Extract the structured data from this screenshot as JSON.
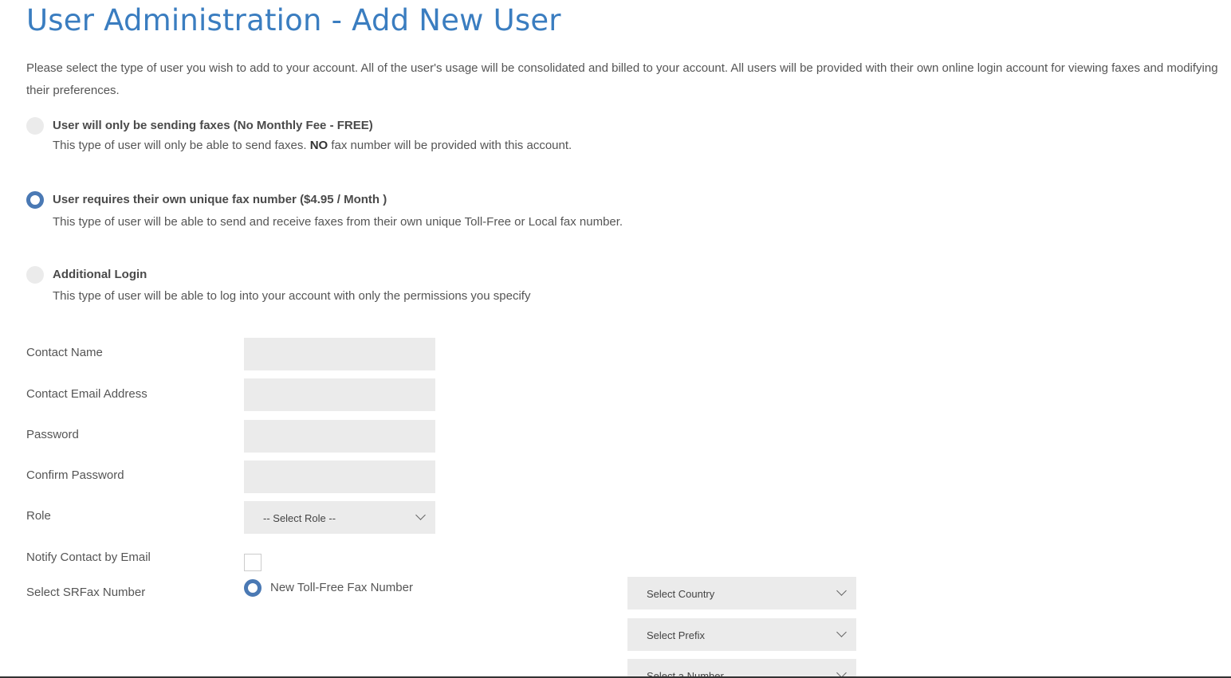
{
  "page": {
    "title": "User Administration - Add New User",
    "intro": "Please select the type of user you wish to add to your account. All of the user's usage will be consolidated and billed to your account. All users will be provided with their own online login account for viewing faxes and modifying their preferences."
  },
  "user_types": [
    {
      "title": "User will only be sending faxes (No Monthly Fee - FREE)",
      "desc_pre": "This type of user will only be able to send faxes.",
      "desc_bold": "NO",
      "desc_post": "fax number will be provided with this account.",
      "selected": false
    },
    {
      "title": "User requires their own unique fax number ($4.95 / Month )",
      "desc": "This type of user will be able to send and receive faxes from their own unique Toll-Free or Local fax number.",
      "selected": true
    },
    {
      "title": "Additional Login",
      "desc": "This type of user will be able to log into your account with only the permissions you specify",
      "selected": false
    }
  ],
  "form": {
    "contact_name_label": "Contact Name",
    "contact_name_value": "",
    "email_label": "Contact Email Address",
    "email_value": "",
    "password_label": "Password",
    "password_value": "",
    "confirm_password_label": "Confirm Password",
    "confirm_password_value": "",
    "role_label": "Role",
    "role_selected": "-- Select Role --",
    "notify_label": "Notify Contact by Email",
    "notify_checked": false,
    "srfax_label": "Select SRFax Number",
    "srfax_option": "New Toll-Free Fax Number",
    "country_selected": "Select Country",
    "prefix_selected": "Select Prefix",
    "number_selected": "Select a Number"
  },
  "colors": {
    "title": "#3a7dc0",
    "radio_selected": "#4a79b4",
    "field_bg": "#ebebeb"
  }
}
